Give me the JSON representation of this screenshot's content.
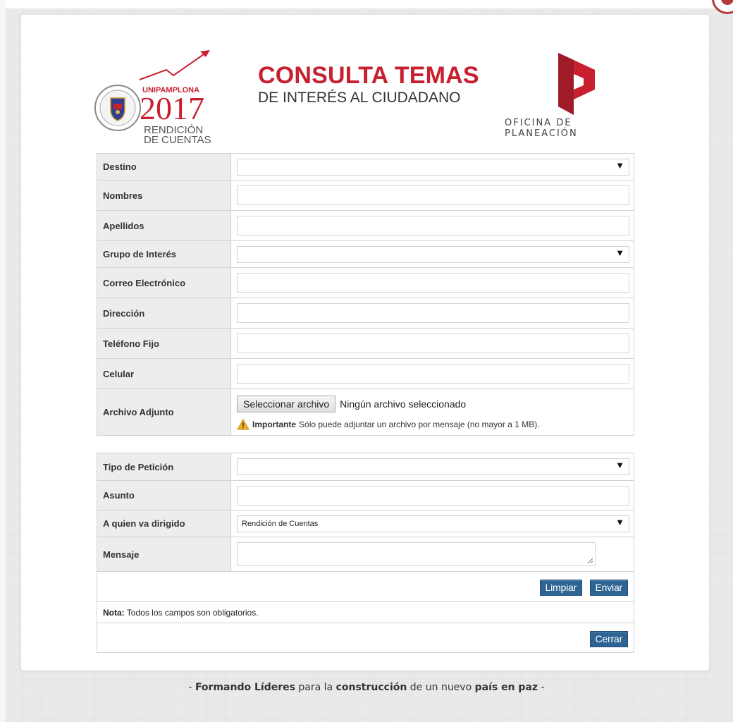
{
  "header": {
    "title_main": "CONSULTA TEMAS",
    "title_sub": "DE INTERÉS AL CIUDADANO",
    "logo_uni": {
      "brand": "UNIPAMPLONA",
      "year": "2017",
      "line1": "RENDICIÓN",
      "line2": "DE CUENTAS"
    },
    "logo_planeacion_label": "OFICINA DE PLANEACIÓN"
  },
  "personal_form": {
    "destino_label": "Destino",
    "destino_value": "",
    "nombres_label": "Nombres",
    "nombres_value": "",
    "apellidos_label": "Apellidos",
    "apellidos_value": "",
    "grupo_label": "Grupo de Interés",
    "grupo_value": "",
    "correo_label": "Correo Electrónico",
    "correo_value": "",
    "direccion_label": "Dirección",
    "direccion_value": "",
    "telefono_label": "Teléfono Fijo",
    "telefono_value": "",
    "celular_label": "Celular",
    "celular_value": "",
    "archivo_label": "Archivo Adjunto",
    "archivo_button": "Seleccionar archivo",
    "archivo_status": "Ningún archivo seleccionado",
    "archivo_note_strong": "Importante",
    "archivo_note_text": "Sólo puede adjuntar un archivo por mensaje (no mayor a 1 MB)."
  },
  "request_form": {
    "tipo_label": "Tipo de Petición",
    "tipo_value": "",
    "asunto_label": "Asunto",
    "asunto_value": "",
    "dirigido_label": "A quien va dirigido",
    "dirigido_value": "Rendición de Cuentas",
    "mensaje_label": "Mensaje",
    "mensaje_value": "",
    "limpiar_button": "Limpiar",
    "enviar_button": "Enviar",
    "nota_strong": "Nota:",
    "nota_text": "Todos los campos son obligatorios.",
    "cerrar_button": "Cerrar"
  },
  "footer": {
    "p1": "- ",
    "b1": "Formando Líderes",
    "p2": " para la ",
    "b2": "construcción",
    "p3": " de un nuevo ",
    "b3": "país en paz",
    "p4": " -"
  },
  "colors": {
    "brand_red": "#c8202f",
    "button_blue": "#2d6493",
    "label_bg": "#ededed"
  },
  "icons": {
    "select_arrow": "▼",
    "warning": "warning-triangle"
  }
}
